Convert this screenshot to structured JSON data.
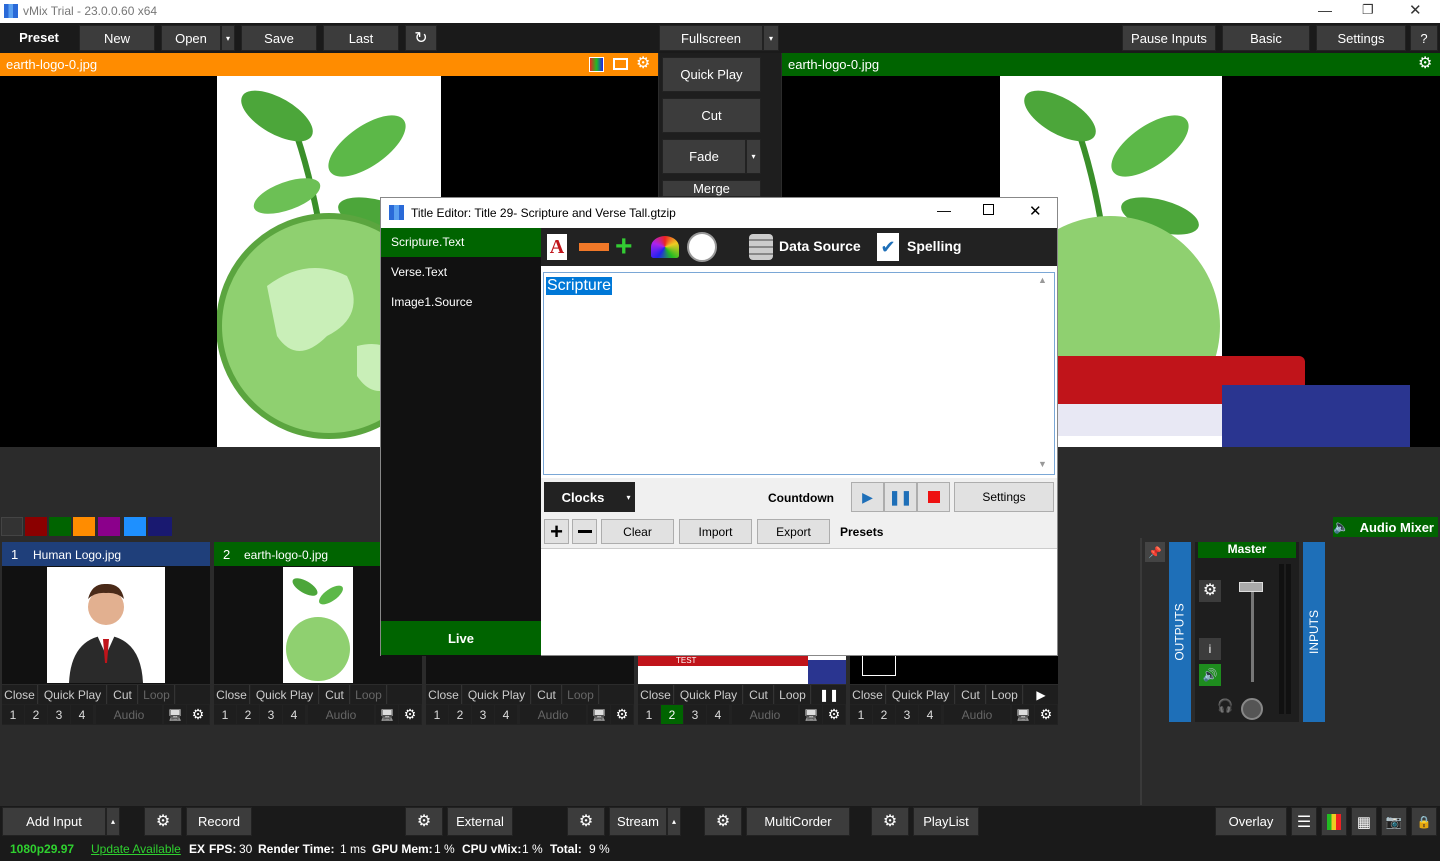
{
  "window": {
    "title": "vMix Trial - 23.0.0.60 x64"
  },
  "toolbar": {
    "preset": "Preset",
    "new": "New",
    "open": "Open",
    "save": "Save",
    "last": "Last",
    "fullscreen": "Fullscreen",
    "pause_inputs": "Pause Inputs",
    "basic": "Basic",
    "settings": "Settings",
    "help": "?"
  },
  "preview": {
    "title": "earth-logo-0.jpg"
  },
  "output": {
    "title": "earth-logo-0.jpg"
  },
  "transitions": {
    "quick_play": "Quick Play",
    "cut": "Cut",
    "fade": "Fade",
    "merge": "Merge"
  },
  "dialog": {
    "title": "Title Editor: Title 29- Scripture and Verse Tall.gtzip",
    "fields": [
      "Scripture.Text",
      "Verse.Text",
      "Image1.Source"
    ],
    "data_source": "Data Source",
    "spelling": "Spelling",
    "text_value": "Scripture",
    "clocks": "Clocks",
    "countdown": "Countdown",
    "settings": "Settings",
    "clear": "Clear",
    "import": "Import",
    "export": "Export",
    "presets": "Presets",
    "live": "Live"
  },
  "inputs": [
    {
      "num": "1",
      "name": "Human Logo.jpg",
      "accent": "#1f3f7a"
    },
    {
      "num": "2",
      "name": "earth-logo-0.jpg",
      "accent": "#006400"
    }
  ],
  "input_controls": {
    "close": "Close",
    "quick_play": "Quick Play",
    "cut": "Cut",
    "loop": "Loop",
    "audio": "Audio",
    "n1": "1",
    "n2": "2",
    "n3": "3",
    "n4": "4"
  },
  "lower_thumb_label": "TEST",
  "audio": {
    "mixer": "Audio Mixer",
    "master": "Master",
    "outputs": "OUTPUTS",
    "inputs": "INPUTS",
    "info": "i"
  },
  "bottom": {
    "add_input": "Add Input",
    "record": "Record",
    "external": "External",
    "stream": "Stream",
    "multicorder": "MultiCorder",
    "playlist": "PlayList",
    "overlay": "Overlay"
  },
  "status": {
    "format": "1080p29.97",
    "update": "Update Available",
    "ex": "EX",
    "fps_label": "FPS:",
    "fps": "30",
    "render_label": "Render Time:",
    "render": "1 ms",
    "gpu_label": "GPU Mem:",
    "gpu": "1 %",
    "cpu_label": "CPU vMix:",
    "cpu": "1 %",
    "total_label": "Total:",
    "total": "9 %"
  },
  "colors": {
    "preview_bar": "#ff8c00",
    "output_bar": "#006400",
    "accent_blue": "#1e6fb8"
  }
}
